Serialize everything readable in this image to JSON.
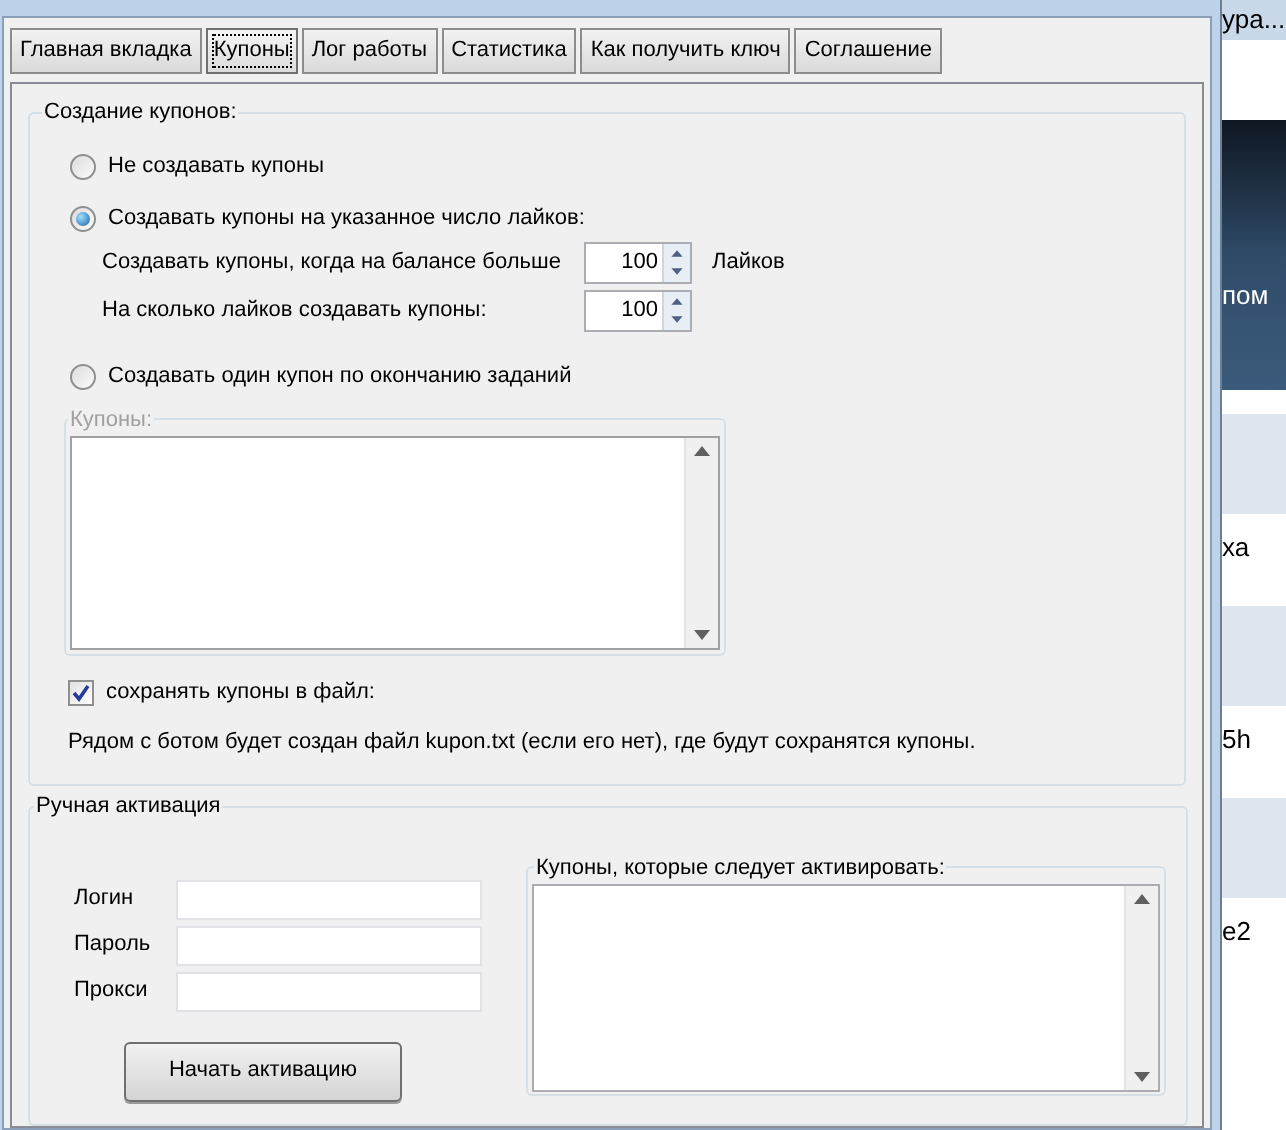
{
  "background_window": {
    "texts": [
      "ура...",
      "пом",
      "ха",
      "5h",
      "е2"
    ]
  },
  "tabs": [
    {
      "label": "Главная вкладка",
      "selected": false
    },
    {
      "label": "Купоны",
      "selected": true
    },
    {
      "label": "Лог работы",
      "selected": false
    },
    {
      "label": "Статистика",
      "selected": false
    },
    {
      "label": "Как получить ключ",
      "selected": false
    },
    {
      "label": "Соглашение",
      "selected": false
    }
  ],
  "coupon_creation": {
    "title": "Создание купонов:",
    "options": [
      {
        "label": "Не создавать купоны",
        "selected": false
      },
      {
        "label": "Создавать купоны на указанное число лайков:",
        "selected": true
      },
      {
        "label": "Создавать один купон по окончанию заданий",
        "selected": false
      }
    ],
    "balance_row": {
      "label": "Создавать купоны, когда на балансе больше",
      "value": "100",
      "unit": "Лайков"
    },
    "amount_row": {
      "label": "На сколько лайков создавать купоны:",
      "value": "100"
    },
    "coupons_box": {
      "title": "Купоны:",
      "disabled": true
    },
    "save_to_file": {
      "label": "сохранять купоны в файл:",
      "checked": true
    },
    "note": "Рядом с ботом будет создан файл kupon.txt (если его нет), где будут сохранятся купоны."
  },
  "manual_activation": {
    "title": "Ручная активация",
    "fields": [
      {
        "label": "Логин"
      },
      {
        "label": "Пароль"
      },
      {
        "label": "Прокси"
      }
    ],
    "coupons_box": {
      "title": "Купоны, которые следует активировать:"
    },
    "button": "Начать активацию"
  }
}
